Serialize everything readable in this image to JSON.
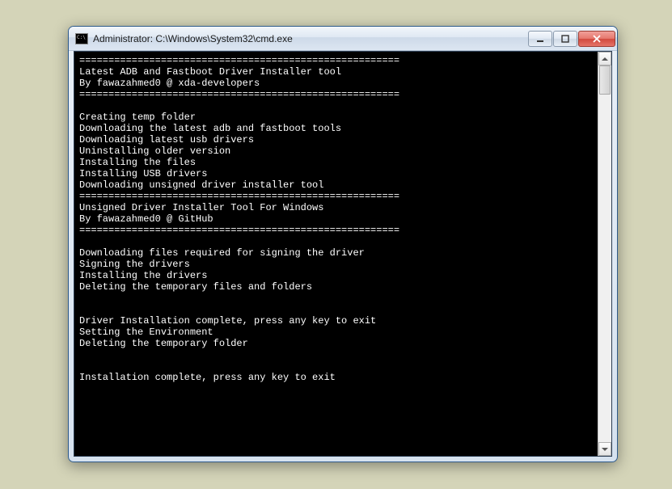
{
  "window": {
    "title": "Administrator: C:\\Windows\\System32\\cmd.exe"
  },
  "lines": {
    "l0": "=======================================================",
    "l1": "Latest ADB and Fastboot Driver Installer tool",
    "l2": "By fawazahmed0 @ xda-developers",
    "l3": "=======================================================",
    "l4": "",
    "l5": "Creating temp folder",
    "l6": "Downloading the latest adb and fastboot tools",
    "l7": "Downloading latest usb drivers",
    "l8": "Uninstalling older version",
    "l9": "Installing the files",
    "l10": "Installing USB drivers",
    "l11": "Downloading unsigned driver installer tool",
    "l12": "=======================================================",
    "l13": "Unsigned Driver Installer Tool For Windows",
    "l14": "By fawazahmed0 @ GitHub",
    "l15": "=======================================================",
    "l16": "",
    "l17": "Downloading files required for signing the driver",
    "l18": "Signing the drivers",
    "l19": "Installing the drivers",
    "l20": "Deleting the temporary files and folders",
    "l21": "",
    "l22": "",
    "l23": "Driver Installation complete, press any key to exit",
    "l24": "Setting the Environment",
    "l25": "Deleting the temporary folder",
    "l26": "",
    "l27": "",
    "l28": "Installation complete, press any key to exit"
  }
}
